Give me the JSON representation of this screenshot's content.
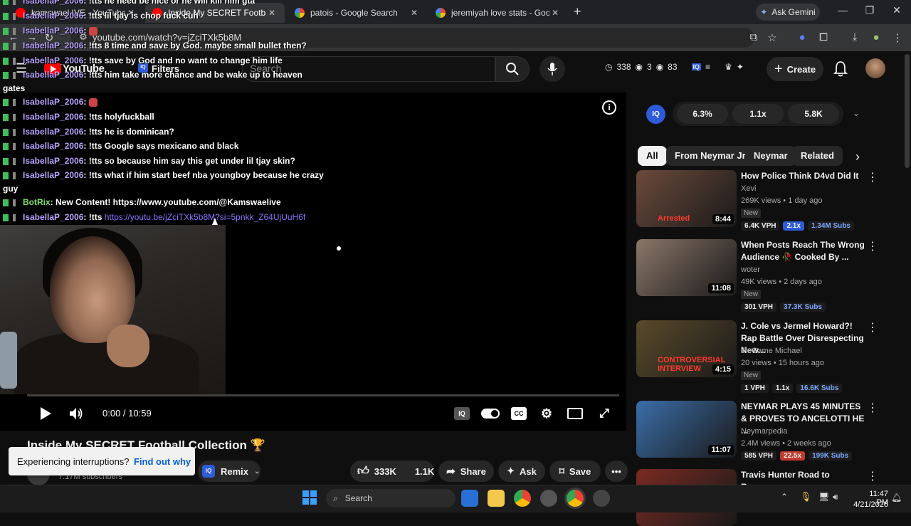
{
  "browser": {
    "tabs": [
      {
        "title": "kamswael IVE - YouTube",
        "active": false
      },
      {
        "title": "Inside My SECRET Football Coll",
        "active": true
      },
      {
        "title": "patois - Google Search",
        "active": false
      },
      {
        "title": "jeremiyah love stats - Google S",
        "active": false
      }
    ],
    "gemini_label": "Ask Gemini",
    "url": "youtube.com/watch?v=jZciTXk5b8M"
  },
  "youtube": {
    "logo_text": "YouTube",
    "filters_label": "Filters",
    "search_placeholder": "Search",
    "header_stats": {
      "views": "338",
      "a": "3",
      "b": "83"
    },
    "create_label": "Create"
  },
  "chat": [
    {
      "user": "IsabellaP_2006",
      "text": ": !tts he need be nice or he will kill him gta"
    },
    {
      "user": "IsabellaP_2006",
      "text": ": !tts lil tjay is chop fuck cuh"
    },
    {
      "user": "IsabellaP_2006",
      "text": ": "
    },
    {
      "user": "IsabellaP_2006",
      "text": ": !tts 8 time and save by God. maybe small bullet then?"
    },
    {
      "user": "IsabellaP_2006",
      "text": ": !tts save by God and no want to change him life"
    },
    {
      "user": "IsabellaP_2006",
      "text": ": !tts him take more chance and be wake up to heaven"
    },
    {
      "user": "IsabellaP_2006",
      "text": ": "
    },
    {
      "user": "IsabellaP_2006",
      "text": ": !tts holyfuckball"
    },
    {
      "user": "IsabellaP_2006",
      "text": ": !tts he is dominican?"
    },
    {
      "user": "IsabellaP_2006",
      "text": ": !tts Google says mexicano and black"
    },
    {
      "user": "IsabellaP_2006",
      "text": ": !tts so because him say this get under lil tjay skin?"
    },
    {
      "user": "IsabellaP_2006",
      "text": ": !tts what if him start beef nba youngboy because he crazy"
    },
    {
      "user": "BotRix",
      "text": ": New Content! https://www.youtube.com/@Kamswaelive"
    },
    {
      "user": "IsabellaP_2006",
      "text": ": !tts ",
      "link": "https://youtu.be/jZciTXk5b8M?si=5pnkk_Z64UjUuH6f"
    }
  ],
  "chat_wraps": [
    "gates",
    "guy"
  ],
  "player": {
    "time": "0:00 / 10:59",
    "progress": 0
  },
  "video": {
    "title": "Inside My SECRET Football Collection 🏆",
    "channel_subs": "7.17M subscribers",
    "remix_label": "Remix",
    "likes": "333K",
    "dislike_count": "1.1K",
    "share_label": "Share",
    "ask_label": "Ask",
    "save_label": "Save"
  },
  "toast": {
    "text": "Experiencing interruptions?",
    "link": "Find out why"
  },
  "iq": {
    "logo": "IQ",
    "stat1": "6.3%",
    "stat2": "1.1x",
    "stat3": "5.8K"
  },
  "chips": [
    "All",
    "From Neymar Jr",
    "Neymar",
    "Related"
  ],
  "recommendations": [
    {
      "title": "How Police Think D4vd Did It",
      "channel": "Xevi",
      "meta": "269K views • 1 day ago",
      "badge": "New",
      "duration": "8:44",
      "vph": "6.4K VPH",
      "mult": "2.1x",
      "subs": "1.34M Subs",
      "thumb_label": "Arrested",
      "color": "#6b4a3a"
    },
    {
      "title": "When Posts Reach The Wrong Audience 🥀 Cooked By ...",
      "channel": "woter",
      "meta": "49K views • 2 days ago",
      "badge": "New",
      "duration": "11:08",
      "vph": "301 VPH",
      "mult": "",
      "subs": "37.3K Subs",
      "thumb_label": "",
      "color": "#8a7668"
    },
    {
      "title": "J. Cole vs Jermel Howard?! Rap Battle Over Disrespecting New...",
      "channel": "TieGame Michael",
      "meta": "20 views • 15 hours ago",
      "badge": "New",
      "duration": "4:15",
      "vph": "1 VPH",
      "mult": "1.1x",
      "subs": "16.6K Subs",
      "thumb_label": "CONTROVERSIAL INTERVIEW",
      "color": "#5a4a2a"
    },
    {
      "title": "NEYMAR PLAYS 45 MINUTES & PROVES TO ANCELOTTI HE ...",
      "channel": "Neymarpedia",
      "meta": "2.4M views • 2 weeks ago",
      "badge": "",
      "duration": "11:07",
      "vph": "585 VPH",
      "mult": "22.5x",
      "subs": "199K Subs",
      "thumb_label": "",
      "color": "#3a6ea8"
    },
    {
      "title": "Travis Hunter Road to Recovery:",
      "channel": "",
      "meta": "",
      "badge": "",
      "duration": "",
      "vph": "",
      "mult": "",
      "subs": "",
      "thumb_label": "",
      "color": "#7a2a22"
    }
  ],
  "taskbar": {
    "search_label": "Search",
    "time": "11:47 PM",
    "date": "4/21/2026"
  }
}
